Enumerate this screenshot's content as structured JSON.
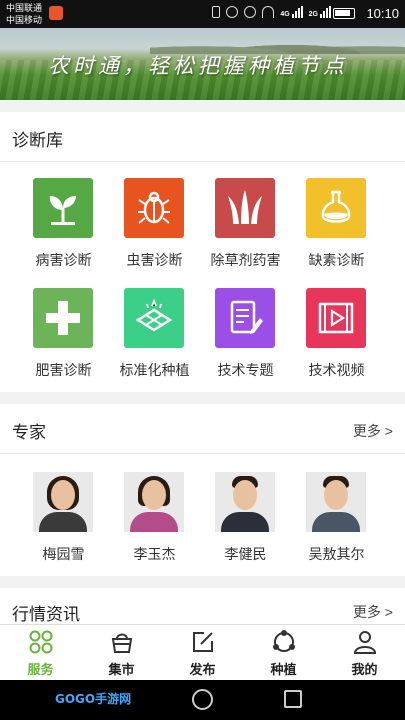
{
  "status_bar": {
    "carrier1": "中国联通",
    "carrier2": "中国移动",
    "network1": "4G",
    "network2": "2G",
    "time": "10:10"
  },
  "banner": {
    "text": "农时通，轻松把握种植节点"
  },
  "diagnosis": {
    "title": "诊断库",
    "items": [
      {
        "label": "病害诊断",
        "icon": "seedling-icon",
        "color": "#56a845"
      },
      {
        "label": "虫害诊断",
        "icon": "bug-icon",
        "color": "#e8541f"
      },
      {
        "label": "除草剂药害",
        "icon": "grass-icon",
        "color": "#c94a4a"
      },
      {
        "label": "缺素诊断",
        "icon": "flask-icon",
        "color": "#f2c02a"
      },
      {
        "label": "肥害诊断",
        "icon": "fertilizer-plus-icon",
        "color": "#6db35a"
      },
      {
        "label": "标准化种植",
        "icon": "field-grid-icon",
        "color": "#3ccf88"
      },
      {
        "label": "技术专题",
        "icon": "document-pen-icon",
        "color": "#9b4fe6"
      },
      {
        "label": "技术视频",
        "icon": "video-play-icon",
        "color": "#e8365b"
      }
    ]
  },
  "experts": {
    "title": "专家",
    "more": "更多 >",
    "items": [
      {
        "name": "梅园雪",
        "shirt": "#3a3a3a"
      },
      {
        "name": "李玉杰",
        "shirt": "#b34d8a"
      },
      {
        "name": "李健民",
        "shirt": "#2b2f3a"
      },
      {
        "name": "吴敖其尔",
        "shirt": "#4a5566"
      }
    ]
  },
  "market": {
    "title": "行情资讯",
    "more": "更多 >"
  },
  "tabbar": {
    "active_color": "#69b33b",
    "tabs": [
      {
        "label": "服务",
        "icon": "grid-service-icon"
      },
      {
        "label": "集市",
        "icon": "basket-icon"
      },
      {
        "label": "发布",
        "icon": "edit-icon"
      },
      {
        "label": "种植",
        "icon": "circle-dots-icon"
      },
      {
        "label": "我的",
        "icon": "user-icon"
      }
    ]
  },
  "system_nav": {
    "logo": "GOGO手游网"
  }
}
